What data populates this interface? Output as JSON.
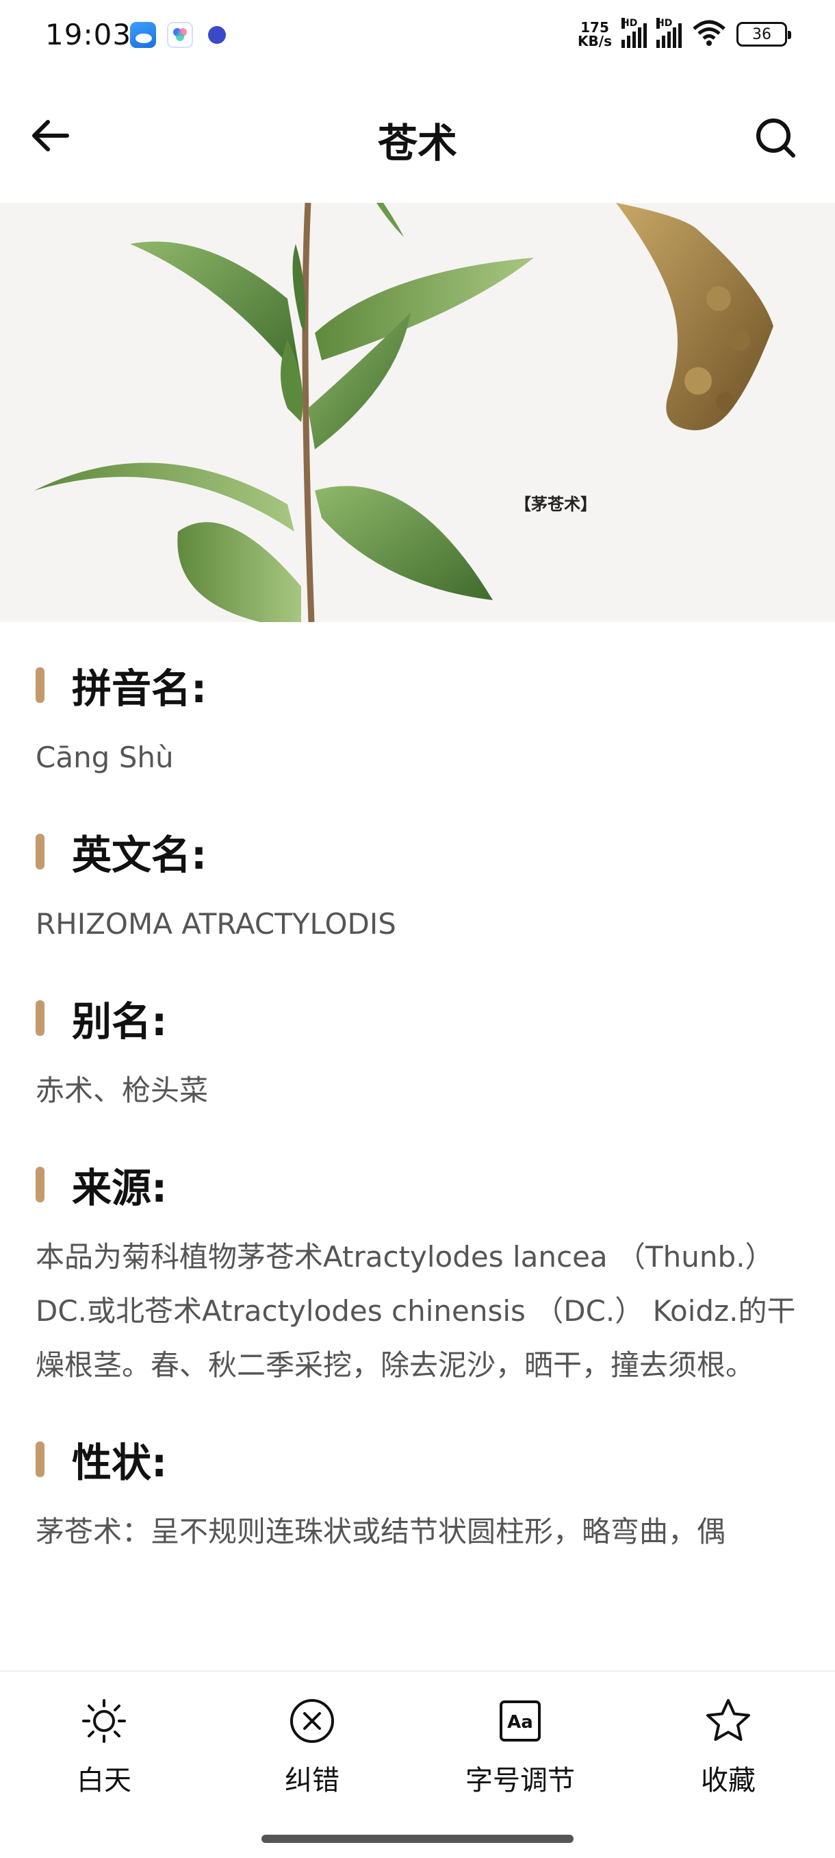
{
  "status_bar": {
    "time": "19:03",
    "net_speed_value": "175",
    "net_speed_unit": "KB/s",
    "signal_label": "HD",
    "battery": "36"
  },
  "header": {
    "title": "苍术",
    "back_icon": "arrow-left-icon",
    "search_icon": "search-icon"
  },
  "hero": {
    "caption": "【茅苍术】"
  },
  "sections": [
    {
      "title": "拼音名:",
      "body": "Cāng Shù"
    },
    {
      "title": "英文名:",
      "body": "RHIZOMA ATRACTYLODIS"
    },
    {
      "title": "别名:",
      "body": "赤术、枪头菜"
    },
    {
      "title": "来源:",
      "body": "本品为菊科植物茅苍术Atractylodes lancea （Thunb.） DC.或北苍术Atractylodes chinensis （DC.） Koidz.的干燥根茎。春、秋二季采挖，除去泥沙，晒干，撞去须根。"
    },
    {
      "title": "性状:",
      "body": "茅苍术：呈不规则连珠状或结节状圆柱形，略弯曲，偶"
    }
  ],
  "bottom_bar": {
    "tabs": [
      {
        "label": "白天",
        "icon": "sun-icon"
      },
      {
        "label": "纠错",
        "icon": "x-circle-icon"
      },
      {
        "label": "字号调节",
        "icon": "font-size-icon"
      },
      {
        "label": "收藏",
        "icon": "star-icon"
      }
    ]
  },
  "colors": {
    "accent": "#c49a6c",
    "text_primary": "#111111",
    "text_secondary": "#555555"
  }
}
